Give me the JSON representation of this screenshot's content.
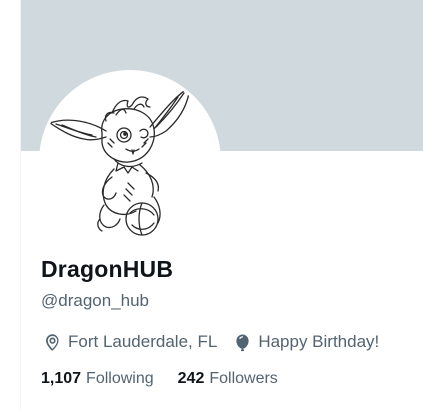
{
  "profile": {
    "display_name": "DragonHUB",
    "handle": "@dragon_hub",
    "location": "Fort Lauderdale, FL",
    "birthday": "Happy Birthday!",
    "following_count": "1,107",
    "following_label": "Following",
    "followers_count": "242",
    "followers_label": "Followers"
  },
  "icons": {
    "location": "map-pin-icon",
    "birthday": "balloon-icon"
  },
  "colors": {
    "banner": "#cfd9de",
    "primary_text": "#0f1419",
    "secondary_text": "#536471"
  }
}
